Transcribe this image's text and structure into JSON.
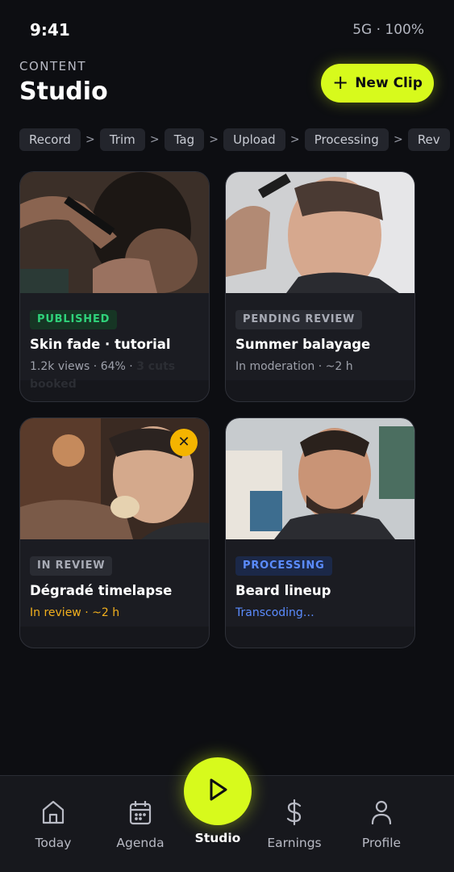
{
  "status_bar": {
    "time": "9:41",
    "network": "5G · 100%"
  },
  "header": {
    "eyebrow": "CONTENT",
    "title": "Studio",
    "new_clip_label": "New Clip"
  },
  "pipeline": {
    "steps": [
      "Record",
      "Trim",
      "Tag",
      "Upload",
      "Processing",
      "Rev"
    ]
  },
  "clips": [
    {
      "status": "PUBLISHED",
      "status_color": "#2fd27a",
      "status_bg": "#163524",
      "title": "Skin fade · tutorial",
      "meta": "1.2k views · 64% · ",
      "meta_extra": "3 cuts booked",
      "meta_color": "#9ea1ab"
    },
    {
      "status": "PENDING REVIEW",
      "status_color": "#a8abb5",
      "status_bg": "#2a2c33",
      "title": "Summer balayage",
      "meta": "In moderation · ~2 h",
      "meta_color": "#9ea1ab"
    },
    {
      "status": "IN REVIEW",
      "status_color": "#a8abb5",
      "status_bg": "#2a2c33",
      "title": "Dégradé timelapse",
      "meta": "In review · ~2 h",
      "meta_color": "#f2b01e",
      "has_close": true
    },
    {
      "status": "PROCESSING",
      "status_color": "#5b8cff",
      "status_bg": "#1b2848",
      "title": "Beard lineup",
      "meta": "Transcoding…",
      "meta_color": "#5b8cff"
    }
  ],
  "nav": {
    "today": "Today",
    "agenda": "Agenda",
    "studio": "Studio",
    "earnings": "Earnings",
    "profile": "Profile"
  },
  "colors": {
    "accent": "#d7fa1c",
    "background": "#0d0e12",
    "card": "#16171c",
    "warning": "#f4b400"
  }
}
